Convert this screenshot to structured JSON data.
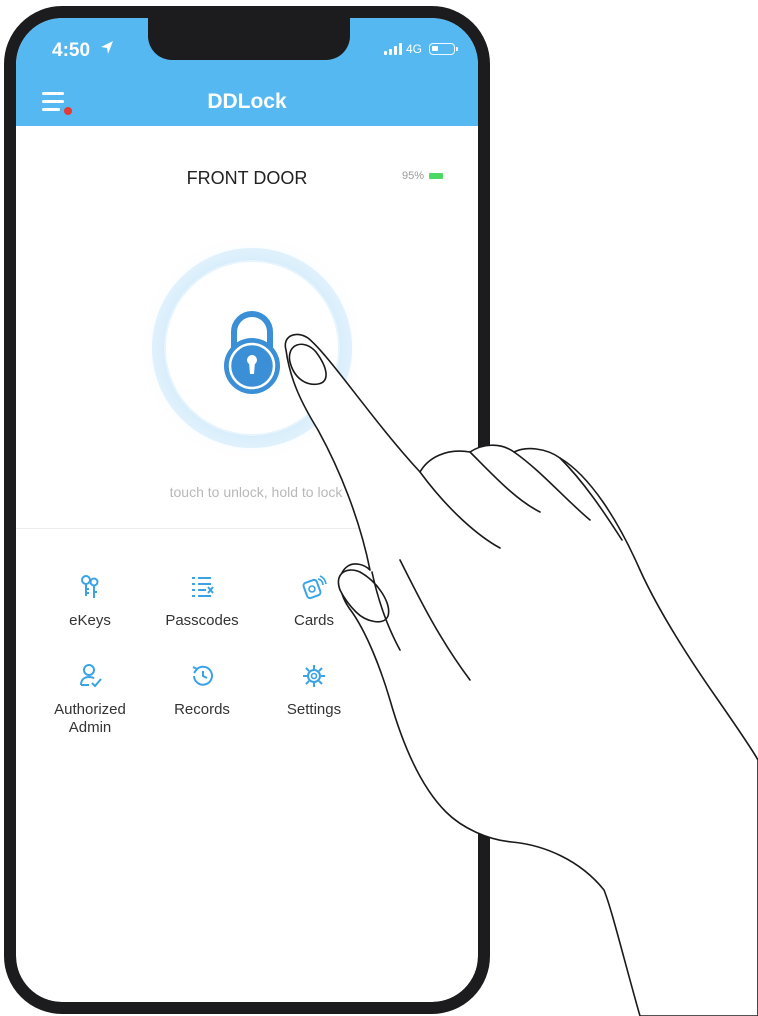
{
  "status_bar": {
    "time": "4:50",
    "network": "4G"
  },
  "nav": {
    "title": "DDLock",
    "menu_icon": "hamburger-menu-icon",
    "notification_dot_color": "#e53935"
  },
  "lock": {
    "name": "FRONT DOOR",
    "battery_percent": "95%",
    "hint": "touch to unlock, hold to lock"
  },
  "functions": [
    {
      "label": "eKeys",
      "icon": "ekeys-icon"
    },
    {
      "label": "Passcodes",
      "icon": "passcodes-icon"
    },
    {
      "label": "Cards",
      "icon": "cards-icon"
    },
    {
      "label": "Authorized Admin",
      "icon": "authorized-admin-icon"
    },
    {
      "label": "Records",
      "icon": "records-icon"
    },
    {
      "label": "Settings",
      "icon": "settings-icon"
    }
  ],
  "colors": {
    "accent": "#55b8f1",
    "lock_blue": "#3a8fd6",
    "battery_green": "#4cd964"
  }
}
